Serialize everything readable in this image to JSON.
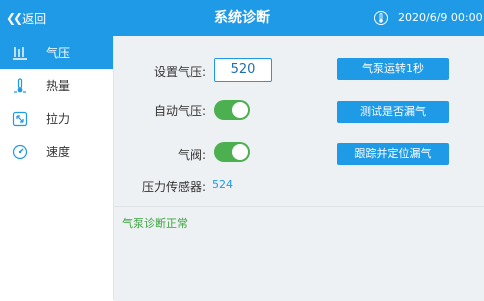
{
  "header": {
    "back_label": "返回",
    "title": "系统诊断",
    "datetime": "2020/6/9  00:00",
    "temp_icon": "thermometer-icon"
  },
  "sidebar": {
    "items": [
      {
        "label": "气压",
        "icon": "pressure-icon",
        "active": true
      },
      {
        "label": "热量",
        "icon": "heat-icon",
        "active": false
      },
      {
        "label": "拉力",
        "icon": "tension-icon",
        "active": false
      },
      {
        "label": "速度",
        "icon": "speed-icon",
        "active": false
      }
    ]
  },
  "main": {
    "set_pressure_label": "设置气压:",
    "set_pressure_value": "520",
    "auto_pressure_label": "自动气压:",
    "auto_pressure_on": true,
    "valve_label": "气阀:",
    "valve_on": true,
    "sensor_label": "压力传感器:",
    "sensor_value": "524",
    "buttons": {
      "pump_run": "气泵运转1秒",
      "leak_test": "测试是否漏气",
      "trace_leak": "跟踪并定位漏气"
    },
    "status_message": "气泵诊断正常"
  },
  "colors": {
    "primary": "#1f9ae6",
    "toggle_on": "#4caf50",
    "status_ok": "#3aa53e",
    "panel_bg": "#eef1f4"
  }
}
